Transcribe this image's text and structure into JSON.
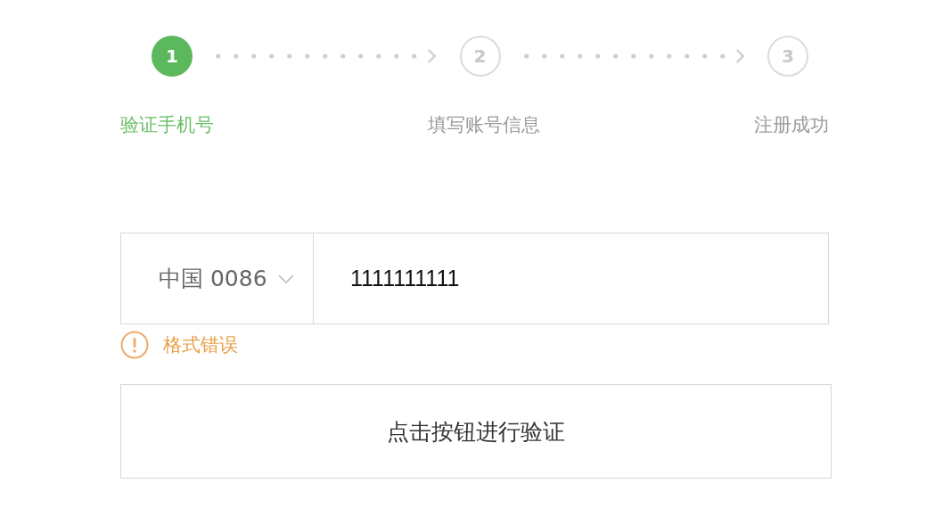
{
  "steps": [
    {
      "number": "1",
      "label": "验证手机号",
      "active": true
    },
    {
      "number": "2",
      "label": "填写账号信息",
      "active": false
    },
    {
      "number": "3",
      "label": "注册成功",
      "active": false
    }
  ],
  "phone": {
    "country": "中国 0086",
    "value": "1111111111"
  },
  "error": {
    "message": "格式错误"
  },
  "verify_button": {
    "label": "点击按钮进行验证"
  }
}
